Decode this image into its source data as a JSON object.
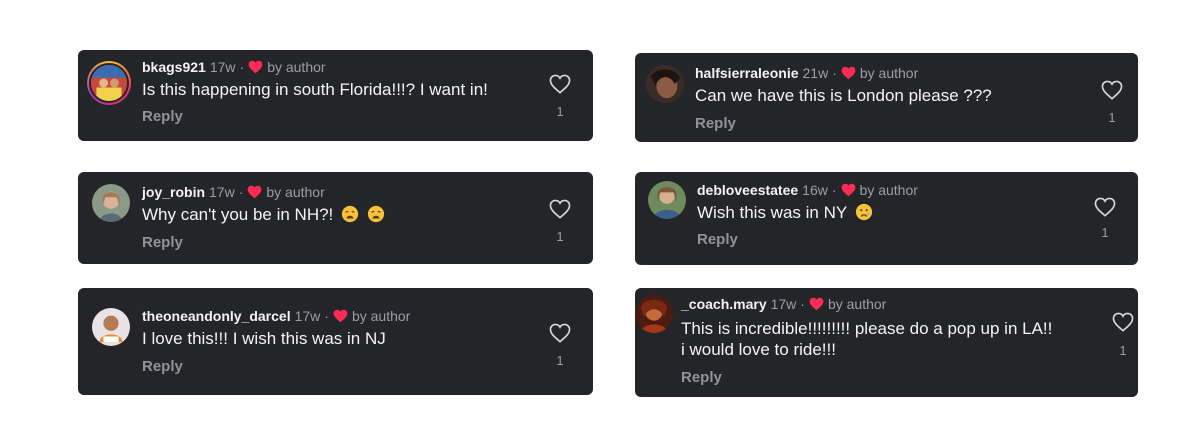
{
  "colors": {
    "card_bg": "#232529",
    "heart_red": "#fe2c55",
    "muted": "#9a9ea6"
  },
  "comments": [
    {
      "username": "bkags921",
      "age": "17w",
      "separator": "·",
      "badge": "by author",
      "text": "Is this happening in south Florida!!!? I want in!",
      "reply": "Reply",
      "likes": "1",
      "avatar_icon": "avatar-photo-icon"
    },
    {
      "username": "joy_robin",
      "age": "17w",
      "separator": "·",
      "badge": "by author",
      "text": "Why can't you be in NH?!",
      "emojis": [
        "weary-face-emoji",
        "weary-face-emoji"
      ],
      "reply": "Reply",
      "likes": "1",
      "avatar_icon": "avatar-photo-icon"
    },
    {
      "username": "theoneandonly_darcel",
      "age": "17w",
      "separator": "·",
      "badge": "by author",
      "text": "I love this!!! I wish this was in NJ",
      "reply": "Reply",
      "likes": "1",
      "avatar_icon": "avatar-photo-icon"
    },
    {
      "username": "halfsierraleonie",
      "age": "21w",
      "separator": "·",
      "badge": "by author",
      "text": "Can we have this is London please ???",
      "reply": "Reply",
      "likes": "1",
      "avatar_icon": "avatar-photo-icon"
    },
    {
      "username": "debloveestatee",
      "age": "16w",
      "separator": "·",
      "badge": "by author",
      "text": "Wish this was in NY",
      "emojis": [
        "crying-face-emoji"
      ],
      "reply": "Reply",
      "likes": "1",
      "avatar_icon": "avatar-photo-icon"
    },
    {
      "username": "_coach.mary",
      "age": "17w",
      "separator": "·",
      "badge": "by author",
      "text_line1": "This is incredible!!!!!!!!! please do a pop up in LA!!",
      "text_line2": "i would love to ride!!!",
      "reply": "Reply",
      "likes": "1",
      "avatar_icon": "avatar-photo-icon"
    }
  ]
}
